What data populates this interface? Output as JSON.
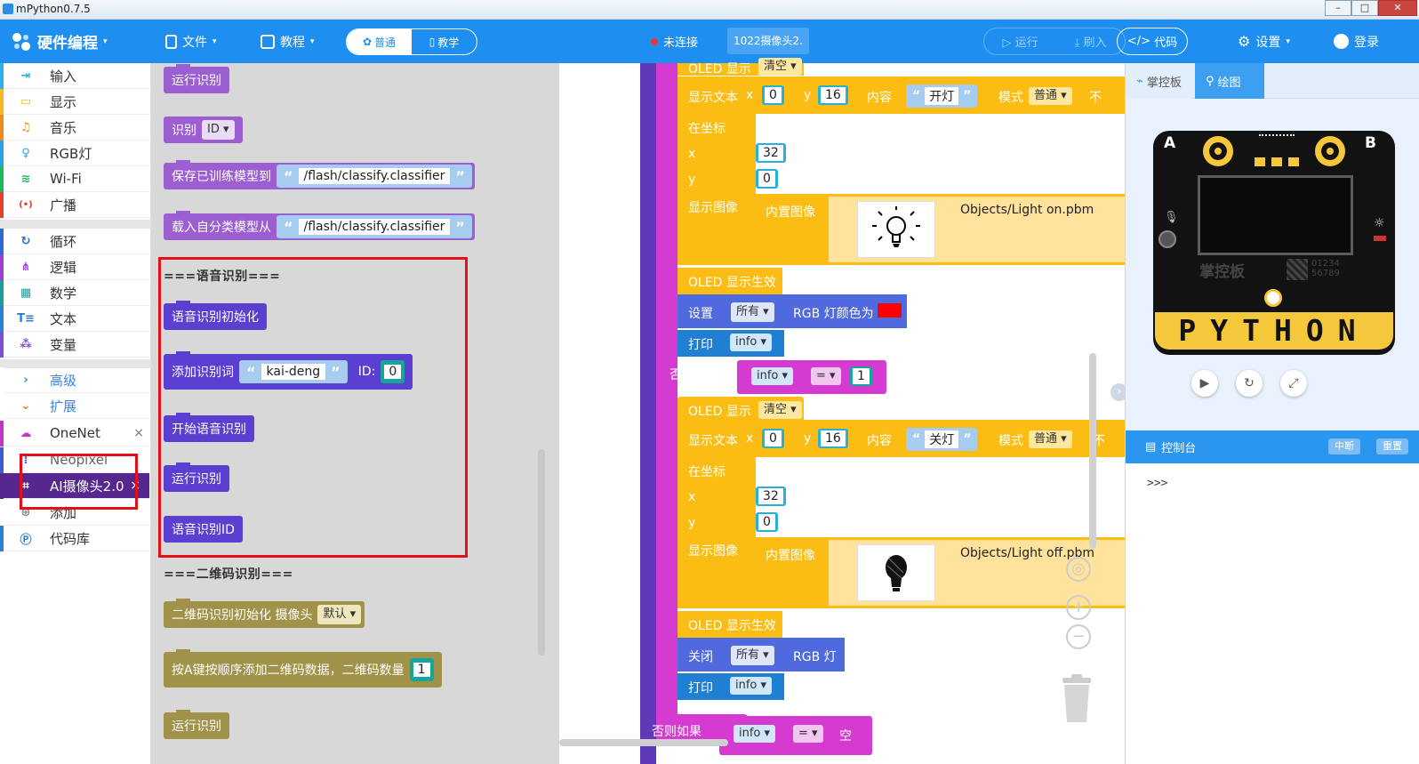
{
  "window": {
    "title": "mPython0.7.5"
  },
  "topbar": {
    "brand": "硬件编程",
    "file": "文件",
    "tutorial": "教程",
    "mode_normal": "普通",
    "mode_teach": "教学",
    "connection": "未连接",
    "device": "1022摄像头2.",
    "run": "运行",
    "flash": "刷入",
    "code": "代码",
    "settings": "设置",
    "login": "登录"
  },
  "sidebar": {
    "items": [
      {
        "label": "输入",
        "color": "#2bb0ea"
      },
      {
        "label": "显示",
        "color": "#f6b91f"
      },
      {
        "label": "音乐",
        "color": "#ef8a1f"
      },
      {
        "label": "RGB灯",
        "color": "#2aa3e6"
      },
      {
        "label": "Wi-Fi",
        "color": "#1eb85c"
      },
      {
        "label": "广播",
        "color": "#e4412c"
      },
      {
        "label": "循环",
        "color": "#2b6ad8"
      },
      {
        "label": "逻辑",
        "color": "#9b3fd6"
      },
      {
        "label": "数学",
        "color": "#1f9b9b"
      },
      {
        "label": "文本",
        "color": "#2d7fd3"
      },
      {
        "label": "变量",
        "color": "#7c4fd6"
      },
      {
        "label": "高级",
        "color": "#3a85e3"
      },
      {
        "label": "扩展",
        "color": "#f26b21"
      },
      {
        "label": "OneNet",
        "color": "#c534c9"
      },
      {
        "label": "Neopixel",
        "color": "#3c5bd1"
      },
      {
        "label": "AI摄像头2.0",
        "color": "#5a2f9f"
      },
      {
        "label": "添加",
        "color": "#888888"
      },
      {
        "label": "代码库",
        "color": "#2d7fd3"
      }
    ]
  },
  "flyout": {
    "b_run1": "运行识别",
    "b_recog": "识别",
    "b_recog_dd": "ID",
    "b_save": "保存已训练模型到",
    "b_save_path": "/flash/classify.classifier",
    "b_load": "载入自分类模型从",
    "b_load_path": "/flash/classify.classifier",
    "sec_voice": "===语音识别===",
    "b_voice_init": "语音识别初始化",
    "b_add_word": "添加识别词",
    "b_add_word_val": "kai-deng",
    "b_add_id_label": "ID:",
    "b_add_id_val": "0",
    "b_voice_start": "开始语音识别",
    "b_run2": "运行识别",
    "b_voice_id": "语音识别ID",
    "sec_qr": "===二维码识别===",
    "b_qr_init": "二维码识别初始化 摄像头",
    "b_qr_init_dd": "默认",
    "b_qr_add": "按A键按顺序添加二维码数据，二维码数量",
    "b_qr_add_val": "1",
    "b_run3": "运行识别"
  },
  "workspace": {
    "oled_show": "OLED 显示",
    "clear": "清空",
    "show_text": "显示文本",
    "x": "x",
    "y": "y",
    "x_val": "0",
    "y_val": "16",
    "content": "内容",
    "text_on": "开灯",
    "text_off": "关灯",
    "mode": "模式",
    "mode_val": "普通",
    "trunc": "不",
    "at_coord": "在坐标",
    "coord_x": "32",
    "coord_y": "0",
    "show_image": "显示图像",
    "builtin_image": "内置图像",
    "img_on": "Objects/Light on.pbm",
    "img_off": "Objects/Light off.pbm",
    "oled_apply": "OLED 显示生效",
    "set": "设置",
    "all": "所有",
    "rgb_color": "RGB 灯颜色为",
    "rgb_color_val": "#ff0000",
    "print": "打印",
    "info": "info",
    "elseif": "否则如果",
    "eq": "=",
    "num1": "1",
    "off": "关闭",
    "rgb": "RGB 灯",
    "empty": "空"
  },
  "right": {
    "tab_board": "掌控板",
    "tab_draw": "绘图",
    "board_label_a": "A",
    "board_label_b": "B",
    "board_brand": "掌控板",
    "board_code1": "01234",
    "board_code2": "56789",
    "board_python": "PYTHON",
    "console_title": "控制台",
    "btn_interrupt": "中断",
    "btn_reset": "重置",
    "prompt": ">>>"
  }
}
